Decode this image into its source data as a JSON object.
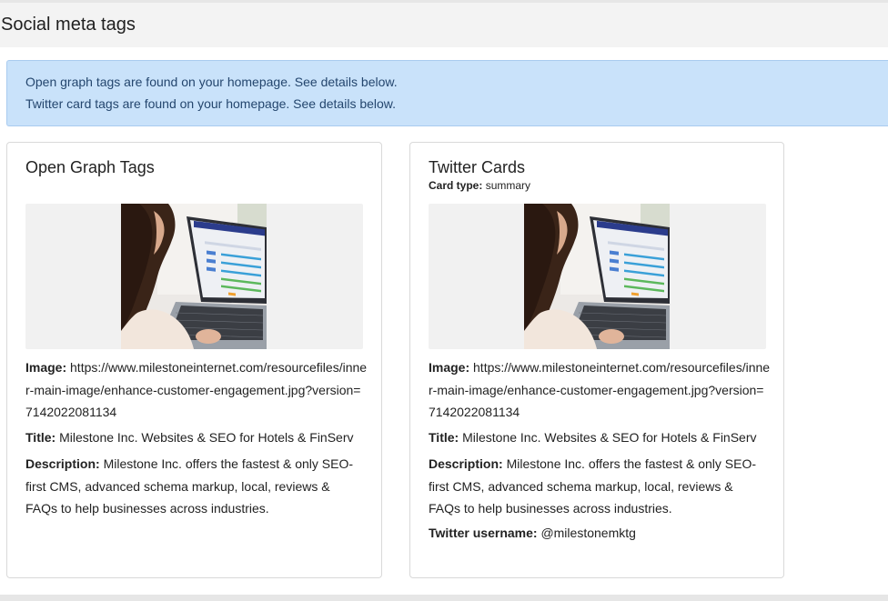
{
  "header": {
    "title": "Social meta tags"
  },
  "alert": {
    "line1": "Open graph tags are found on your homepage. See details below.",
    "line2": "Twitter card tags are found on your homepage. See details below."
  },
  "open_graph": {
    "title": "Open Graph Tags",
    "image_label": "Image:",
    "image_value": "https://www.milestoneinternet.com/resourcefiles/inner-main-image/enhance-customer-engagement.jpg?version=7142022081134",
    "title_label": "Title:",
    "title_value": "Milestone Inc. Websites & SEO for Hotels & FinServ",
    "description_label": "Description:",
    "description_value": "Milestone Inc. offers the fastest & only SEO-first CMS, advanced schema markup, local, reviews & FAQs to help businesses across industries."
  },
  "twitter": {
    "title": "Twitter Cards",
    "card_type_label": "Card type:",
    "card_type_value": "summary",
    "image_label": "Image:",
    "image_value": "https://www.milestoneinternet.com/resourcefiles/inner-main-image/enhance-customer-engagement.jpg?version=7142022081134",
    "title_label": "Title:",
    "title_value": "Milestone Inc. Websites & SEO for Hotels & FinServ",
    "description_label": "Description:",
    "description_value": "Milestone Inc. offers the fastest & only SEO-first CMS, advanced schema markup, local, reviews & FAQs to help businesses across industries.",
    "username_label": "Twitter username:",
    "username_value": "@milestonemktg"
  },
  "colors": {
    "alert_bg": "#c9e2fa",
    "alert_text": "#24466e",
    "header_bg": "#f3f3f3",
    "card_border": "#d9d9d9"
  }
}
